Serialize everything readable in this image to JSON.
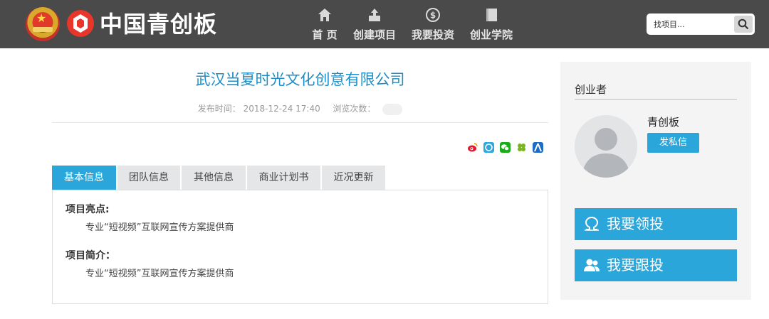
{
  "header": {
    "logo_text": "中国青创板",
    "nav": [
      {
        "label": "首 页",
        "icon": "home-icon"
      },
      {
        "label": "创建项目",
        "icon": "upload-icon"
      },
      {
        "label": "我要投资",
        "icon": "dollar-icon"
      },
      {
        "label": "创业学院",
        "icon": "book-icon"
      }
    ],
    "search": {
      "placeholder": "找项目...",
      "icon": "search-icon"
    }
  },
  "main": {
    "company": "武汉当夏时光文化创意有限公司",
    "publish_label": "发布时间：",
    "publish_time": "2018-12-24 17:40",
    "views_label": "浏览次数：",
    "share_icons": [
      "weibo-icon",
      "qzone-icon",
      "wechat-icon",
      "kaixin-icon",
      "renren-icon"
    ],
    "tabs": [
      "基本信息",
      "团队信息",
      "其他信息",
      "商业计划书",
      "近况更新"
    ],
    "active_tab": "基本信息",
    "sections": [
      {
        "title": "项目亮点:",
        "body": "专业“短视频”互联网宣传方案提供商"
      },
      {
        "title": "项目简介：",
        "body": "专业“短视频”互联网宣传方案提供商"
      }
    ]
  },
  "sidebar": {
    "heading": "创业者",
    "founder_name": "青创板",
    "message_button": "发私信",
    "lead_invest": "我要领投",
    "follow_invest": "我要跟投"
  },
  "colors": {
    "header_bg": "#4a4a4a",
    "accent": "#2aa6db",
    "title_blue": "#1d8ec7"
  }
}
